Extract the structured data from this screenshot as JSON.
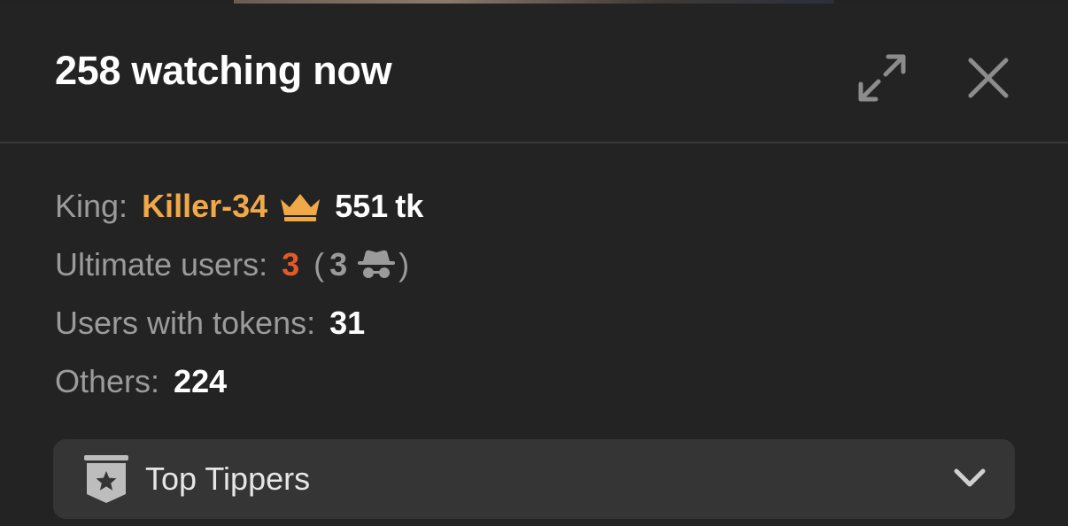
{
  "header": {
    "title": "258 watching now",
    "expand_icon": "expand-arrows-icon",
    "close_icon": "close-x-icon"
  },
  "stats": {
    "king": {
      "label": "King:",
      "name": "Killer-34",
      "icon": "crown-icon",
      "amount": "551",
      "unit": "tk"
    },
    "ultimate": {
      "label": "Ultimate users:",
      "count": "3",
      "open_paren": "(",
      "incognito_count": "3",
      "icon": "incognito-spy-icon",
      "close_paren": ")"
    },
    "with_tokens": {
      "label": "Users with tokens:",
      "count": "31"
    },
    "others": {
      "label": "Others:",
      "count": "224"
    }
  },
  "dropdown": {
    "label": "Top Tippers",
    "icon": "star-badge-icon",
    "chevron": "chevron-down-icon"
  },
  "colors": {
    "background": "#232323",
    "king_name": "#f0a948",
    "ultimate_count": "#e25a2c",
    "label_grey": "#9b9b9b",
    "dropdown_bg": "#353535"
  }
}
